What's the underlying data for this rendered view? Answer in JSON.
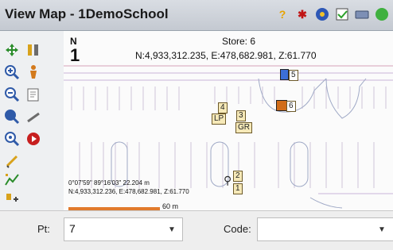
{
  "window": {
    "title": "View Map - 1DemoSchool"
  },
  "toolbar_top": {
    "icons": [
      "help-icon",
      "star-snap-icon",
      "settings-icon",
      "edit-check-icon",
      "keyboard-icon",
      "green-icon"
    ]
  },
  "map": {
    "north_label": "N",
    "north_value": "1",
    "store_label": "Store: 6",
    "store_coords": "N:4,933,312.235, E:478,682.981, Z:61.770",
    "bottom_line1": "0°07'59\" 89°16'03\" 22.204 m",
    "bottom_line2": "N:4,933,312.236, E:478,682.981, Z:61.770",
    "scale_label": "60 m",
    "points": [
      {
        "id": "5",
        "label": "5"
      },
      {
        "id": "6",
        "label": "6"
      },
      {
        "id": "4",
        "label": "4"
      },
      {
        "id": "lp",
        "label": "LP"
      },
      {
        "id": "3",
        "label": "3"
      },
      {
        "id": "gr",
        "label": "GR"
      },
      {
        "id": "2",
        "label": "2"
      },
      {
        "id": "1",
        "label": "1"
      }
    ]
  },
  "form": {
    "pt_label": "Pt:",
    "pt_value": "7",
    "code_label": "Code:",
    "code_value": ""
  }
}
